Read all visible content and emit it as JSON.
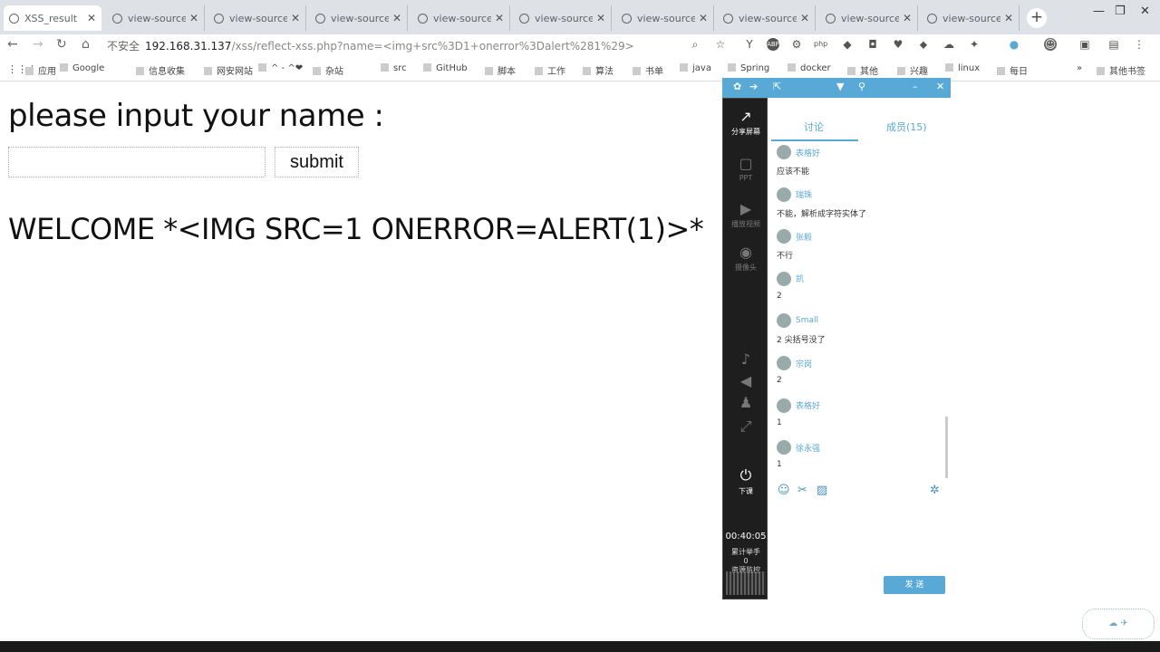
{
  "tabs": [
    {
      "title": "XSS_result",
      "active": true
    },
    {
      "title": "view-source"
    },
    {
      "title": "view-source"
    },
    {
      "title": "view-source"
    },
    {
      "title": "view-source"
    },
    {
      "title": "view-source"
    },
    {
      "title": "view-source"
    },
    {
      "title": "view-source"
    },
    {
      "title": "view-source"
    },
    {
      "title": "view-source"
    }
  ],
  "window": {
    "new_tab": "+",
    "minimize": "—",
    "maximize": "❐",
    "close": "✕"
  },
  "address": {
    "security": "不安全",
    "host": "192.168.31.137",
    "path": "/xss/reflect-xss.php?name=<img+src%3D1+onerror%3Dalert%281%29>"
  },
  "bookmarks": [
    "应用",
    "Google",
    "信息收集",
    "网安网站",
    "^ - ^❤",
    "杂站",
    "src",
    "GitHub",
    "脚本",
    "工作",
    "算法",
    "书单",
    "java",
    "Spring",
    "docker",
    "其他",
    "兴趣",
    "linux",
    "每日"
  ],
  "bookmarks_overflow": "»",
  "other_bookmarks": "其他书签",
  "page": {
    "prompt": "please input your name :",
    "submit_label": "submit",
    "input_value": "",
    "welcome_text": "WELCOME *<IMG SRC=1 ONERROR=ALERT(1)>*"
  },
  "panel": {
    "sidebar": [
      {
        "label": "分享屏幕",
        "icon": "↗",
        "active": true
      },
      {
        "label": "PPT",
        "icon": "▢"
      },
      {
        "label": "播放视频",
        "icon": "▶"
      },
      {
        "label": "摄像头",
        "icon": "◉"
      }
    ],
    "timer": "00:40:05",
    "raise_hand_label": "累计举手",
    "raise_hand_count": "0",
    "resource_label": "资源监控",
    "end_class_label": "下课",
    "tabs": [
      "讨论",
      "成员(15)"
    ],
    "messages": [
      {
        "user": "表格好",
        "text": "应该不能"
      },
      {
        "user": "瑞珠",
        "text": "不能，解析成字符实体了"
      },
      {
        "user": "张毅",
        "text": "不行"
      },
      {
        "user": "凯",
        "text": "2"
      },
      {
        "user": "Small",
        "text": "2 尖括号没了"
      },
      {
        "user": "宗岗",
        "text": "2"
      },
      {
        "user": "表格好",
        "text": "1"
      },
      {
        "user": "徐永强",
        "text": "1"
      }
    ],
    "send_label": "发 送"
  }
}
